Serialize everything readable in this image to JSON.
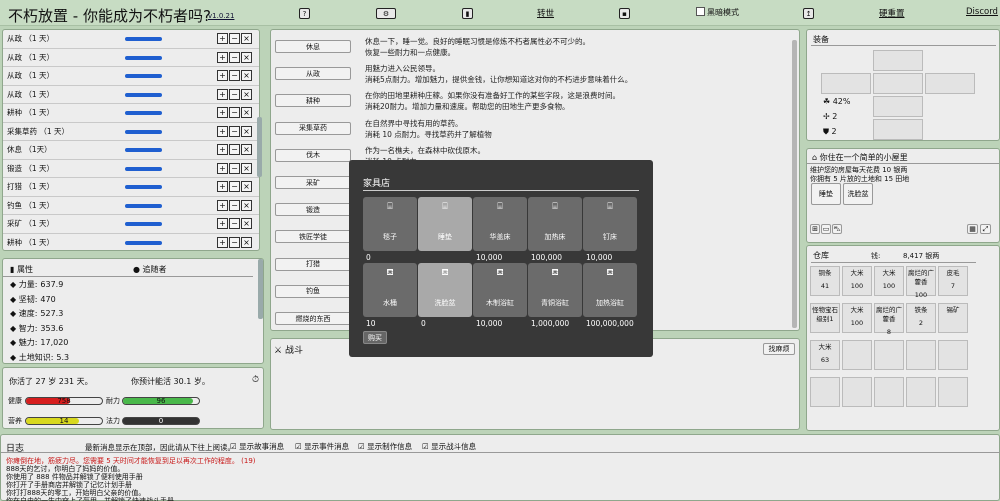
{
  "topbar": {
    "title": "不朽放置 - 你能成为不朽者吗?",
    "version": "v1.0.21",
    "transfer": "转世",
    "blackout": "黑暗模式",
    "hard_reset": "硬重置",
    "discord": "Discord"
  },
  "actions": [
    {
      "label": "从政 （1 天）"
    },
    {
      "label": "从政 （1 天）"
    },
    {
      "label": "从政 （1 天）"
    },
    {
      "label": "从政 （1 天）"
    },
    {
      "label": "耕种 （1 天）"
    },
    {
      "label": "采集草药 （1 天）"
    },
    {
      "label": "休息 （1天）"
    },
    {
      "label": "锻造 （1 天）"
    },
    {
      "label": "打猎 （1 天）"
    },
    {
      "label": "钓鱼 （1 天）"
    },
    {
      "label": "采矿 （1 天）"
    },
    {
      "label": "耕种 （1 天）"
    }
  ],
  "attributes": {
    "tab_attr": "属性",
    "tab_follow": "追随者",
    "items": [
      {
        "icon": "fist-icon",
        "label": "力量:",
        "value": "637.9"
      },
      {
        "icon": "shield-icon",
        "label": "坚韧:",
        "value": "470"
      },
      {
        "icon": "speed-icon",
        "label": "速度:",
        "value": "527.3"
      },
      {
        "icon": "brain-icon",
        "label": "智力:",
        "value": "353.6"
      },
      {
        "icon": "charm-icon",
        "label": "魅力:",
        "value": "17,020"
      },
      {
        "icon": "land-icon",
        "label": "土地知识:",
        "value": "5.3"
      }
    ]
  },
  "vitals": {
    "age": "你活了 27 岁 231 天。",
    "expect": "你预计能活 30.1 岁。",
    "health": "健康",
    "health_val": "758",
    "health_frac": 0.58,
    "stamina": "耐力",
    "stamina_val": "96",
    "stamina_frac": 0.92,
    "nutrition": "营养",
    "nutrition_val": "14",
    "nutrition_frac": 0.7,
    "mana": "法力",
    "mana_val": "0",
    "mana_frac": 0
  },
  "center": {
    "rows": [
      {
        "btn": "休息",
        "lines": [
          "休息一下，睡一觉。良好的睡眠习惯是修炼不朽者属性必不可少的。",
          "恢复一些耐力和一点健康。"
        ]
      },
      {
        "btn": "从政",
        "lines": [
          "用魅力进入公民领导。",
          "消耗5点耐力。增加魅力，提供金钱，让你想知道这对你的不朽进步意味着什么。"
        ]
      },
      {
        "btn": "耕种",
        "lines": [
          "在你的田地里耕种庄稼。如果你没有准备好工作的某些字段，这是浪费时间。",
          "消耗20耐力。增加力量和速度。帮助您的田地生产更多食物。"
        ]
      },
      {
        "btn": "采集草药",
        "lines": [
          "在自然界中寻找有用的草药。",
          "消耗 10 点耐力。寻找草药并了解植物"
        ]
      },
      {
        "btn": "伐木",
        "lines": [
          "作为一名樵夫，在森林中砍伐原木。",
          "消耗 10 点耐力。"
        ]
      },
      {
        "btn": "采矿",
        "lines": []
      },
      {
        "btn": "锻造",
        "lines": []
      },
      {
        "btn": "铁匠学徒",
        "lines": []
      },
      {
        "btn": "打猎",
        "lines": []
      },
      {
        "btn": "钓鱼",
        "lines": []
      },
      {
        "btn": "燃烧的东西",
        "lines": []
      }
    ],
    "fight": "战斗",
    "fight_btn": "找麻烦"
  },
  "equip": {
    "title": "装备",
    "luck": "42%",
    "atk": "2",
    "def": "2"
  },
  "home": {
    "title": "你住在一个简单的小屋里",
    "desc1": "维护您的房屋每天花费 10 银两",
    "desc2": "你拥有 5 片放的土地和 15 田地",
    "items": [
      "睡垫",
      "洗脸盆"
    ]
  },
  "storage": {
    "title": "仓库",
    "money_label": "钱:",
    "money": "8,417 银两",
    "items": [
      {
        "name": "铜条",
        "count": "41"
      },
      {
        "name": "大米",
        "count": "100"
      },
      {
        "name": "大米",
        "count": "100"
      },
      {
        "name": "腐烂的广藿香",
        "count": "100"
      },
      {
        "name": "皮毛",
        "count": "7"
      },
      {
        "name": "怪物宝石 级别1",
        "count": ""
      },
      {
        "name": "大米",
        "count": "100"
      },
      {
        "name": "腐烂的广藿香",
        "count": "8"
      },
      {
        "name": "铁条",
        "count": "2"
      },
      {
        "name": "锡矿",
        "count": ""
      },
      {
        "name": "大米",
        "count": "63"
      }
    ]
  },
  "log": {
    "title": "日志",
    "note": "最新消息显示在顶部，因此请从下往上阅读。",
    "opt1": "显示故事消息",
    "opt2": "显示事件消息",
    "opt3": "显示制作信息",
    "opt4": "显示战斗信息",
    "lines": [
      "你瘫倒在地，筋疲力尽。您需要 5 天时间才能恢复到足以再次工作的程度。 (19)",
      "888天的乞讨，你明白了妈妈的价值。",
      "你使用了 888 件物品并解锁了便利使用手册",
      "你打开了手册商店并解锁了记忆计划手册",
      "你打打888天的零工，开始明白父亲的价值。",
      "你在自由的一生中穿上了盔甲，并解锁了快速战斗手册"
    ]
  },
  "modal": {
    "title": "家具店",
    "buy": "购买",
    "items": [
      {
        "name": "毯子",
        "price": "0",
        "icon": "bed-icon",
        "sel": false
      },
      {
        "name": "睡垫",
        "price": "",
        "icon": "bed-icon",
        "sel": true
      },
      {
        "name": "华盖床",
        "price": "10,000",
        "icon": "bed-icon",
        "sel": false
      },
      {
        "name": "加热床",
        "price": "100,000",
        "icon": "bed-icon",
        "sel": false
      },
      {
        "name": "钉床",
        "price": "10,000",
        "icon": "bed-icon",
        "sel": false
      },
      {
        "name": "水桶",
        "price": "10",
        "icon": "tub-icon",
        "sel": false
      },
      {
        "name": "洗脸盆",
        "price": "0",
        "icon": "tub-icon",
        "sel": true
      },
      {
        "name": "木制浴缸",
        "price": "10,000",
        "icon": "tub-icon",
        "sel": false
      },
      {
        "name": "青铜浴缸",
        "price": "1,000,000",
        "icon": "tub-icon",
        "sel": false
      },
      {
        "name": "加热浴缸",
        "price": "100,000,000",
        "icon": "tub-icon",
        "sel": false
      }
    ]
  }
}
